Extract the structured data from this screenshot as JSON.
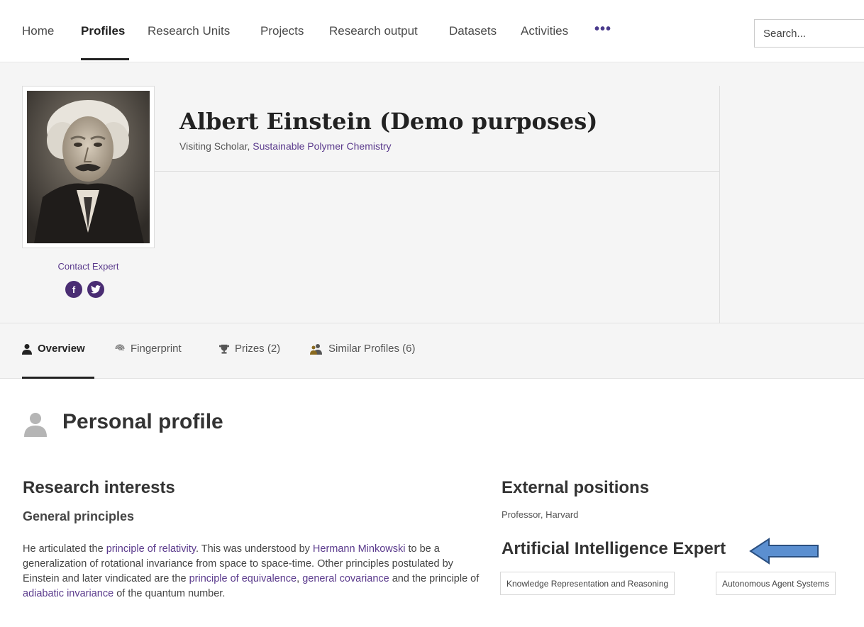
{
  "nav": {
    "items": [
      "Home",
      "Profiles",
      "Research Units",
      "Projects",
      "Research output",
      "Datasets",
      "Activities"
    ],
    "more_label": "•••",
    "search_placeholder": "Search..."
  },
  "profile": {
    "name": "Albert Einstein (Demo purposes)",
    "role_prefix": "Visiting Scholar, ",
    "unit": "Sustainable Polymer Chemistry",
    "contact_label": "Contact Expert",
    "social": [
      "f",
      "t"
    ]
  },
  "tabs": [
    {
      "label": "Overview",
      "icon": "person-icon"
    },
    {
      "label": "Fingerprint",
      "icon": "fingerprint-icon"
    },
    {
      "label": "Prizes (2)",
      "icon": "trophy-icon"
    },
    {
      "label": "Similar Profiles (6)",
      "icon": "people-icon"
    }
  ],
  "content": {
    "section_title": "Personal profile",
    "research_interests": "Research interests",
    "general_principles": "General principles",
    "paragraph": {
      "t1": "He articulated the ",
      "l1": "principle of relativity",
      "t2": ". This was understood by ",
      "l2": "Hermann Minkowski",
      "t3": " to be a generalization of rotational invariance from space to space-time. Other principles postulated by Einstein and later vindicated are the ",
      "l3": "principle of equivalence",
      "t4": ", ",
      "l4": "general covariance",
      "t5": " and the principle of ",
      "l5": "adiabatic invariance",
      "t6": " of the quantum number."
    },
    "external_positions": "External positions",
    "external_value": "Professor, Harvard",
    "ai_heading": "Artificial Intelligence Expert",
    "keywords": [
      "Knowledge Representation and Reasoning",
      "Autonomous Agent Systems"
    ]
  },
  "colors": {
    "accent": "#4a2d73",
    "link": "#5a3a8c",
    "arrow_fill": "#5b8fd0"
  }
}
